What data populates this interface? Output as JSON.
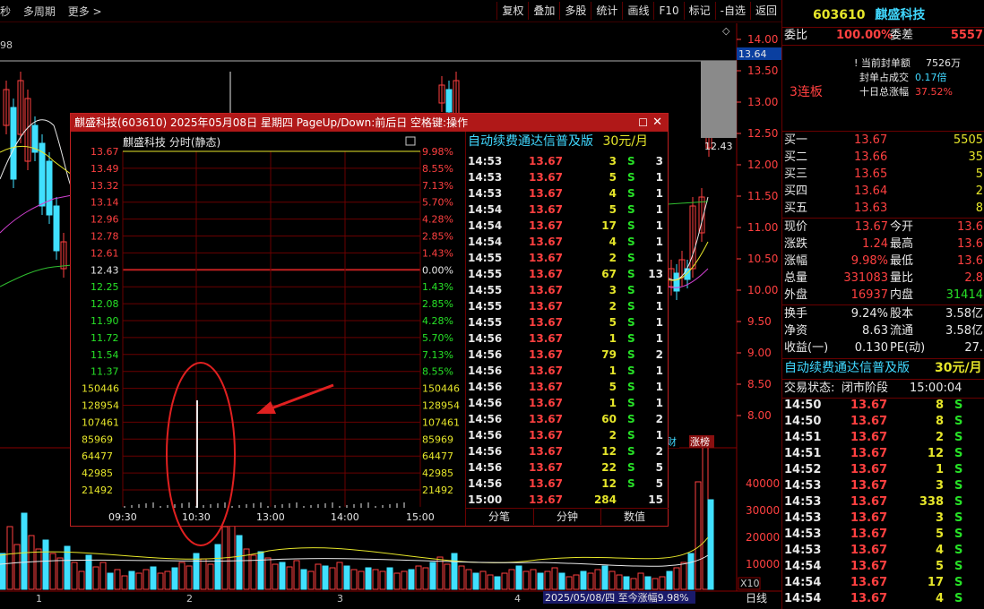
{
  "toolbar": {
    "left_items": [
      "秒",
      "多周期",
      "更多 >"
    ],
    "buttons": [
      "复权",
      "叠加",
      "多股",
      "统计",
      "画线",
      "F10",
      "标记",
      "-自选",
      "返回"
    ]
  },
  "chart": {
    "left_top_label": "98",
    "price_axis": [
      "14.00",
      "13.50",
      "13.00",
      "12.50",
      "12.00",
      "11.50",
      "11.00",
      "10.50",
      "10.00",
      "9.50",
      "9.00",
      "8.50",
      "8.00"
    ],
    "current_price_tag": "13.64",
    "marker_tag": "12.43",
    "volume_axis": [
      "40000",
      "30000",
      "20000",
      "10000"
    ],
    "volume_scale": "X10",
    "bottom_axis": [
      "1",
      "2",
      "3",
      "4"
    ],
    "period_button": "日线",
    "date_banner": "2025/05/08/四  至今涨幅9.98%",
    "badge_1": "财",
    "badge_2": "涨榜",
    "pane_label": "3连板",
    "top_right_label": "ᐃ"
  },
  "popup": {
    "title": "麒盛科技(603610) 2025年05月08日 星期四 PageUp/Down:前后日 空格键:操作",
    "subtitle": "麒盛科技  分时(静态)",
    "left_prices": [
      "13.67",
      "13.49",
      "13.32",
      "13.14",
      "12.96",
      "12.78",
      "12.61",
      "12.43",
      "12.25",
      "12.08",
      "11.90",
      "11.72",
      "11.54",
      "11.37"
    ],
    "right_pcts": [
      "9.98%",
      "8.55%",
      "7.13%",
      "5.70%",
      "4.28%",
      "2.85%",
      "1.43%",
      "0.00%",
      "1.43%",
      "2.85%",
      "4.28%",
      "5.70%",
      "7.13%",
      "8.55%"
    ],
    "volume_labels": [
      "150446",
      "128954",
      "107461",
      "85969",
      "64477",
      "42985",
      "21492"
    ],
    "time_labels": [
      "09:30",
      "10:30",
      "13:00",
      "14:00",
      "15:00"
    ],
    "ad_text": "自动续费通达信普及版",
    "ad_price": "30元/月",
    "ticks": [
      {
        "time": "14:53",
        "price": "13.67",
        "vol": "3",
        "bs": "S",
        "n": "3"
      },
      {
        "time": "14:53",
        "price": "13.67",
        "vol": "5",
        "bs": "S",
        "n": "1"
      },
      {
        "time": "14:53",
        "price": "13.67",
        "vol": "4",
        "bs": "S",
        "n": "1"
      },
      {
        "time": "14:54",
        "price": "13.67",
        "vol": "5",
        "bs": "S",
        "n": "1"
      },
      {
        "time": "14:54",
        "price": "13.67",
        "vol": "17",
        "bs": "S",
        "n": "1"
      },
      {
        "time": "14:54",
        "price": "13.67",
        "vol": "4",
        "bs": "S",
        "n": "1"
      },
      {
        "time": "14:55",
        "price": "13.67",
        "vol": "2",
        "bs": "S",
        "n": "1"
      },
      {
        "time": "14:55",
        "price": "13.67",
        "vol": "67",
        "bs": "S",
        "n": "13"
      },
      {
        "time": "14:55",
        "price": "13.67",
        "vol": "3",
        "bs": "S",
        "n": "1"
      },
      {
        "time": "14:55",
        "price": "13.67",
        "vol": "2",
        "bs": "S",
        "n": "1"
      },
      {
        "time": "14:55",
        "price": "13.67",
        "vol": "5",
        "bs": "S",
        "n": "1"
      },
      {
        "time": "14:56",
        "price": "13.67",
        "vol": "1",
        "bs": "S",
        "n": "1"
      },
      {
        "time": "14:56",
        "price": "13.67",
        "vol": "79",
        "bs": "S",
        "n": "2"
      },
      {
        "time": "14:56",
        "price": "13.67",
        "vol": "1",
        "bs": "S",
        "n": "1"
      },
      {
        "time": "14:56",
        "price": "13.67",
        "vol": "5",
        "bs": "S",
        "n": "1"
      },
      {
        "time": "14:56",
        "price": "13.67",
        "vol": "1",
        "bs": "S",
        "n": "1"
      },
      {
        "time": "14:56",
        "price": "13.67",
        "vol": "60",
        "bs": "S",
        "n": "2"
      },
      {
        "time": "14:56",
        "price": "13.67",
        "vol": "2",
        "bs": "S",
        "n": "1"
      },
      {
        "time": "14:56",
        "price": "13.67",
        "vol": "12",
        "bs": "S",
        "n": "2"
      },
      {
        "time": "14:56",
        "price": "13.67",
        "vol": "22",
        "bs": "S",
        "n": "5"
      },
      {
        "time": "14:56",
        "price": "13.67",
        "vol": "12",
        "bs": "S",
        "n": "5"
      },
      {
        "time": "15:00",
        "price": "13.67",
        "vol": "284",
        "bs": "",
        "n": "15"
      }
    ],
    "tabs": [
      "分笔",
      "分钟",
      "数值"
    ]
  },
  "quote": {
    "code": "603610",
    "name": "麒盛科技",
    "weibi_label": "委比",
    "weibi_value": "100.00%",
    "weicha_label": "委差",
    "weicha_value": "5557",
    "seal_amount_label": "当前封单额",
    "seal_amount_value": "7526万",
    "seal_ratio_label": "封单占成交",
    "seal_ratio_value": "0.17倍",
    "ten_day_label": "十日总涨幅",
    "ten_day_value": "37.52%",
    "board_label": "3连板",
    "bids": [
      {
        "label": "买一",
        "price": "13.67",
        "vol": "5505"
      },
      {
        "label": "买二",
        "price": "13.66",
        "vol": "35"
      },
      {
        "label": "买三",
        "price": "13.65",
        "vol": "5"
      },
      {
        "label": "买四",
        "price": "13.64",
        "vol": "2"
      },
      {
        "label": "买五",
        "price": "13.63",
        "vol": "8"
      }
    ],
    "stats": [
      {
        "l1": "现价",
        "v1": "13.67",
        "l2": "今开",
        "v2": "13.6"
      },
      {
        "l1": "涨跌",
        "v1": "1.24",
        "l2": "最高",
        "v2": "13.6"
      },
      {
        "l1": "涨幅",
        "v1": "9.98%",
        "l2": "最低",
        "v2": "13.6"
      },
      {
        "l1": "总量",
        "v1": "331083",
        "l2": "量比",
        "v2": "2.8"
      },
      {
        "l1": "外盘",
        "v1": "16937",
        "l2": "内盘",
        "v2": "31414"
      }
    ],
    "stats2": [
      {
        "l1": "换手",
        "v1": "9.24%",
        "l2": "股本",
        "v2": "3.58亿"
      },
      {
        "l1": "净资",
        "v1": "8.63",
        "l2": "流通",
        "v2": "3.58亿"
      },
      {
        "l1": "收益(一)",
        "v1": "0.130",
        "l2": "PE(动)",
        "v2": "27."
      }
    ],
    "ad_text": "自动续费通达信普及版",
    "ad_price": "30元/月",
    "status_label": "交易状态:",
    "status_value": "闭市阶段",
    "status_time": "15:00:04",
    "ticks": [
      {
        "time": "14:50",
        "price": "13.67",
        "vol": "8",
        "bs": "S"
      },
      {
        "time": "14:50",
        "price": "13.67",
        "vol": "8",
        "bs": "S"
      },
      {
        "time": "14:51",
        "price": "13.67",
        "vol": "2",
        "bs": "S"
      },
      {
        "time": "14:51",
        "price": "13.67",
        "vol": "12",
        "bs": "S"
      },
      {
        "time": "14:52",
        "price": "13.67",
        "vol": "1",
        "bs": "S"
      },
      {
        "time": "14:53",
        "price": "13.67",
        "vol": "3",
        "bs": "S"
      },
      {
        "time": "14:53",
        "price": "13.67",
        "vol": "338",
        "bs": "S"
      },
      {
        "time": "14:53",
        "price": "13.67",
        "vol": "3",
        "bs": "S"
      },
      {
        "time": "14:53",
        "price": "13.67",
        "vol": "5",
        "bs": "S"
      },
      {
        "time": "14:53",
        "price": "13.67",
        "vol": "4",
        "bs": "S"
      },
      {
        "time": "14:54",
        "price": "13.67",
        "vol": "5",
        "bs": "S"
      },
      {
        "time": "14:54",
        "price": "13.67",
        "vol": "17",
        "bs": "S"
      },
      {
        "time": "14:54",
        "price": "13.67",
        "vol": "4",
        "bs": "S"
      }
    ]
  }
}
